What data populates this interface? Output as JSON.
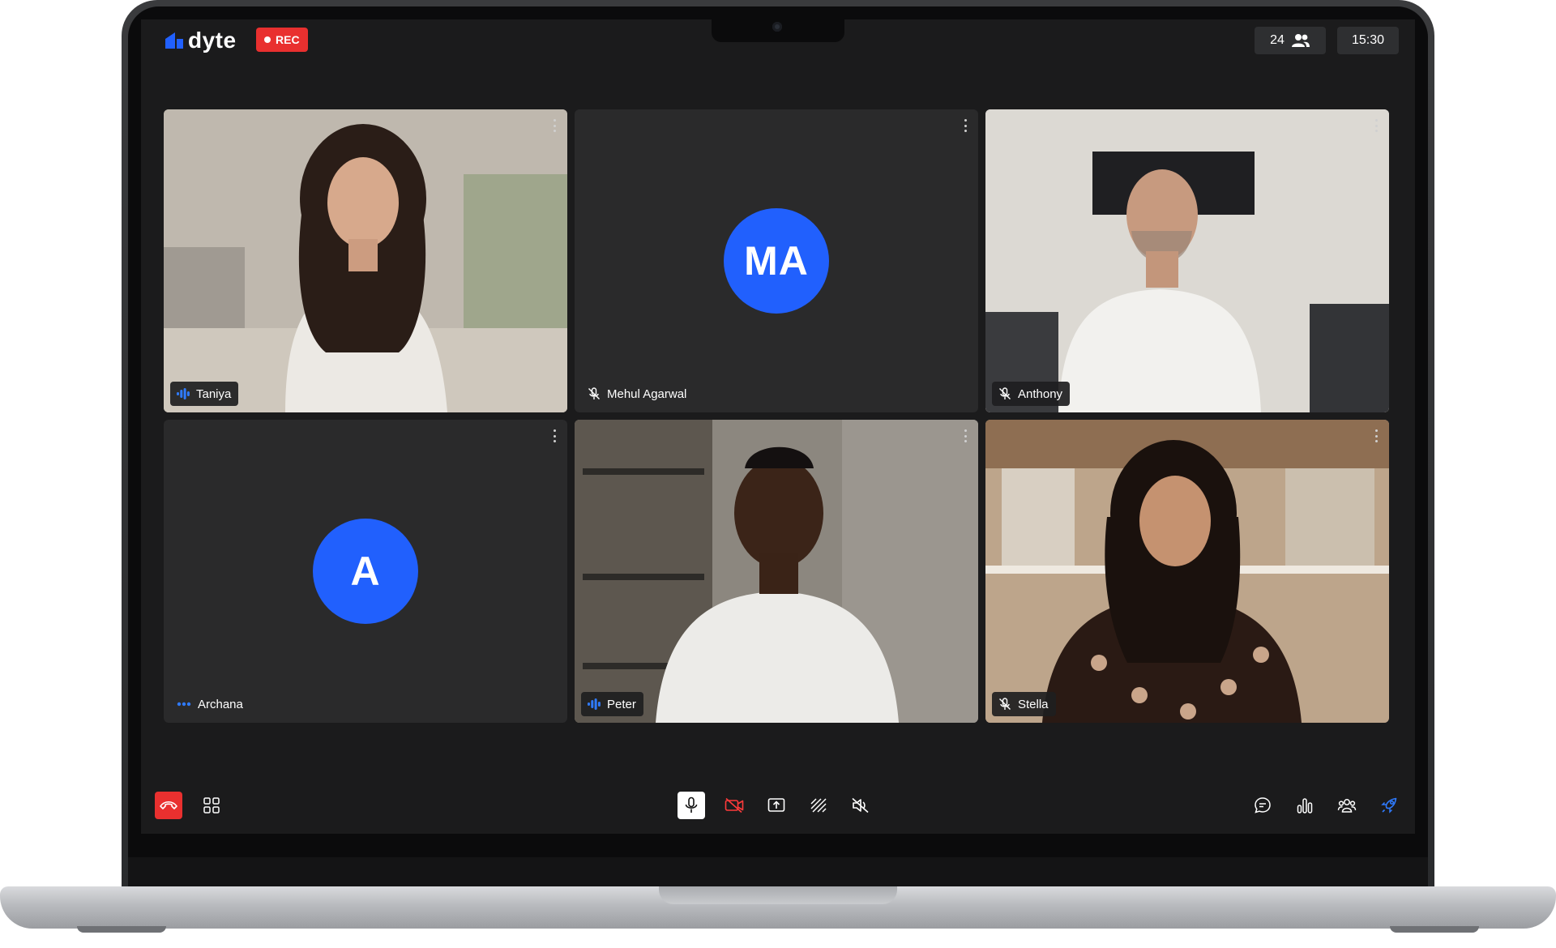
{
  "header": {
    "logo_text": "dyte",
    "rec_label": "REC",
    "participant_count": "24",
    "clock": "15:30"
  },
  "tiles": [
    {
      "name": "Taniya",
      "status": "speaking",
      "type": "video"
    },
    {
      "name": "Mehul Agarwal",
      "initials": "MA",
      "status": "muted",
      "type": "avatar"
    },
    {
      "name": "Anthony",
      "status": "muted",
      "type": "video"
    },
    {
      "name": "Archana",
      "initials": "A",
      "status": "connecting",
      "type": "avatar"
    },
    {
      "name": "Peter",
      "status": "speaking",
      "type": "video"
    },
    {
      "name": "Stella",
      "status": "muted",
      "type": "video"
    }
  ],
  "controls": {
    "left": [
      "leave-call-icon",
      "grid-layout-icon"
    ],
    "center": [
      "microphone-icon",
      "camera-off-icon",
      "screen-share-icon",
      "virtual-background-icon",
      "speaker-mute-icon"
    ],
    "right": [
      "chat-icon",
      "polls-icon",
      "participants-icon",
      "plugins-icon"
    ]
  },
  "colors": {
    "accent": "#2160fd",
    "record": "#e9302f",
    "stage": "#1b1b1c",
    "tile": "#2a2a2b"
  }
}
